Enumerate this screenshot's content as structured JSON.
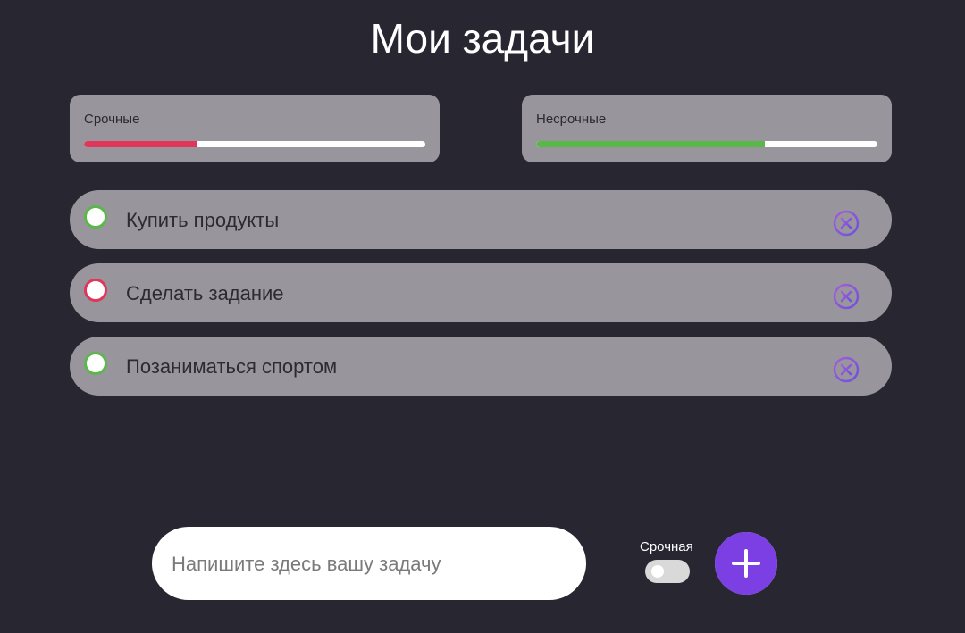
{
  "header": {
    "title": "Мои задачи"
  },
  "progress": {
    "urgent": {
      "label": "Срочные",
      "fraction": 0.33,
      "color": "#e0365a"
    },
    "nonurgent": {
      "label": "Несрочные",
      "fraction": 0.67,
      "color": "#5ab84a"
    }
  },
  "tasks": [
    {
      "text": "Купить продукты",
      "urgent": false,
      "check_color": "#5ab84a",
      "icon": "delete-icon"
    },
    {
      "text": "Сделать задание",
      "urgent": true,
      "check_color": "#e0365a",
      "icon": "delete-icon"
    },
    {
      "text": "Позаниматься спортом",
      "urgent": false,
      "check_color": "#5ab84a",
      "icon": "delete-icon"
    }
  ],
  "composer": {
    "placeholder": "Напишите здесь вашу задачу",
    "value": "",
    "urgent_label": "Срочная",
    "urgent_on": false,
    "add_icon": "plus-icon"
  },
  "colors": {
    "background": "#282631",
    "card": "#98969c",
    "accent": "#7b3fe4",
    "delete": "#8f5bd9"
  }
}
